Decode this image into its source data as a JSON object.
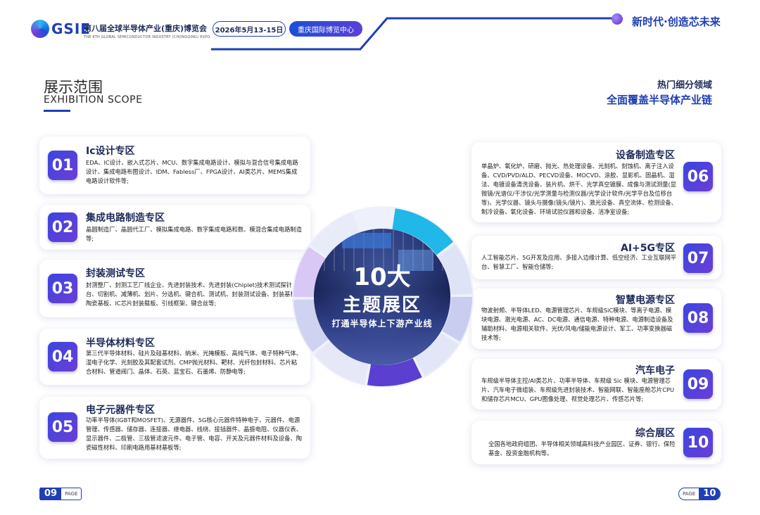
{
  "header": {
    "logo_text": "GSIE",
    "expo_cn": "第八届全球半导体产业(重庆)博览会",
    "expo_en": "THE 8TH GLOBAL SEMICONDUCTOR INDUSTRY (CHONGQING) EXPO",
    "date": "2026年5月13-15日",
    "venue": "重庆国际博览中心",
    "slogan": "新时代·创造芯未来"
  },
  "section": {
    "title_cn": "展示范围",
    "title_en": "EXHIBITION SCOPE",
    "sub1": "热门细分领域",
    "sub2": "全面覆盖半导体产业链"
  },
  "center": {
    "big1": "10大",
    "big2": "主题展区",
    "sub": "打通半导体上下游产业线"
  },
  "zones": [
    {
      "num": "01",
      "title": "Ic设计专区",
      "body": "EDA、IC设计、嵌入式芯片、MCU、数字集成电路设计、模拟与混合信号集成电路设计、集成电路布图设计、IDM、Fabless厂、FPGA设计、AI类芯片、MEMS集成电路设计软件等;"
    },
    {
      "num": "02",
      "title": "集成电路制造专区",
      "body": "晶圆制造厂、晶圆代工厂、模拟集成电路、数字集成电路和数、模混合集成电路制造等;"
    },
    {
      "num": "03",
      "title": "封装测试专区",
      "body": "封测整厂、封测工艺厂线企业、先进封装技术、先进封装(Chiplet)技术测试探针台、切割机、减薄机、划片、分选机、键合机、测试机、封装测试设备、封装基板、陶瓷基板、IC芯片封装载板、引线框架、键合丝等;"
    },
    {
      "num": "04",
      "title": "半导体材料专区",
      "body": "第三代半导体材料、硅片及硅基材料、纳米、光掩模板、高纯气体、电子特种气体、湿电子化学、光刻胶及其配套试剂、CMP抛光材料、靶材、光纤包封材料、芯片粘合材料、管道阀门、晶体、石英、蓝宝石、石墨烯、防静电等;"
    },
    {
      "num": "05",
      "title": "电子元器件专区",
      "body": "功率半导体(IGBT和MOSFET)、无源器件、5G核心元器件特种电子、元器件、电源管理、传感器、储存器、连接器、继电器、线绕、接插器件、晶振电阻、仪器仪表、显示器件、二极管、三极管滤波元件、电子管、电容、开关及元器件材料及设备、陶瓷磁性材料、印刷电路用基材基板等;"
    },
    {
      "num": "06",
      "title": "设备制造专区",
      "body": "单晶炉、氧化炉、研磨、抛光、热处理设备、光刻机、刻蚀机、离子注入设备、CVD/PVD/ALD、PECVD设备、MOCVD、涂胶、显影机、固晶机、湿法、电镀设备清洗设备、装片机、烘干、光学真空镀膜、成像与测试测量(显微镜/光谱仪/干涉仪/光学测量与检测仪器/光学设计软件/光学平台及位移台等)、光学仪器、镜头与摄像(镜头/镜片)、激光设备、真空流体、检测设备、制冷设备、氧化设备、环境试验仪器和设备、洁净室设备;"
    },
    {
      "num": "07",
      "title": "AI+5G专区",
      "body": "人工智能芯片、5G开发及应用、多接入边缘计算、低空经济、工业互联网平台、智慧工厂、智能仓储等;"
    },
    {
      "num": "08",
      "title": "智慧电源专区",
      "body": "物波射频、半导体LED、电源管理芯片、车规级SiC模块、等离子电源、模块电源、激光电源、AC、DC电源、通信电源、特种电源、电源制造设备及辅助材料、电源相关软件、光伏/风电/储能电源设计、军工、功率变换器磁技术等;"
    },
    {
      "num": "09",
      "title": "汽车电子",
      "body": "车规级半导体主控/AI类芯片、功率半导体、车规级 Sic 模块、电源管理芯片、汽车电子微组装、车规级先进封装技术、智能网联、智能座舱芯片CPU和储存芯片MCU、GPU图像处理、视觉处理芯片、传感芯片等;"
    },
    {
      "num": "10",
      "title": "综合展区",
      "body": "全国各地政府组团、半导体相关领域高科技产业园区、证券、银行、保险基金、投资金融机构等。"
    }
  ],
  "pages": {
    "left_num": "09",
    "left_label": "PAGE",
    "right_num": "10",
    "right_label": "PAGE"
  },
  "colors": {
    "brand_blue": "#1f3fb3",
    "accent_purple": "#6a3ed6",
    "ring_cyan": "#1fb8e8"
  }
}
